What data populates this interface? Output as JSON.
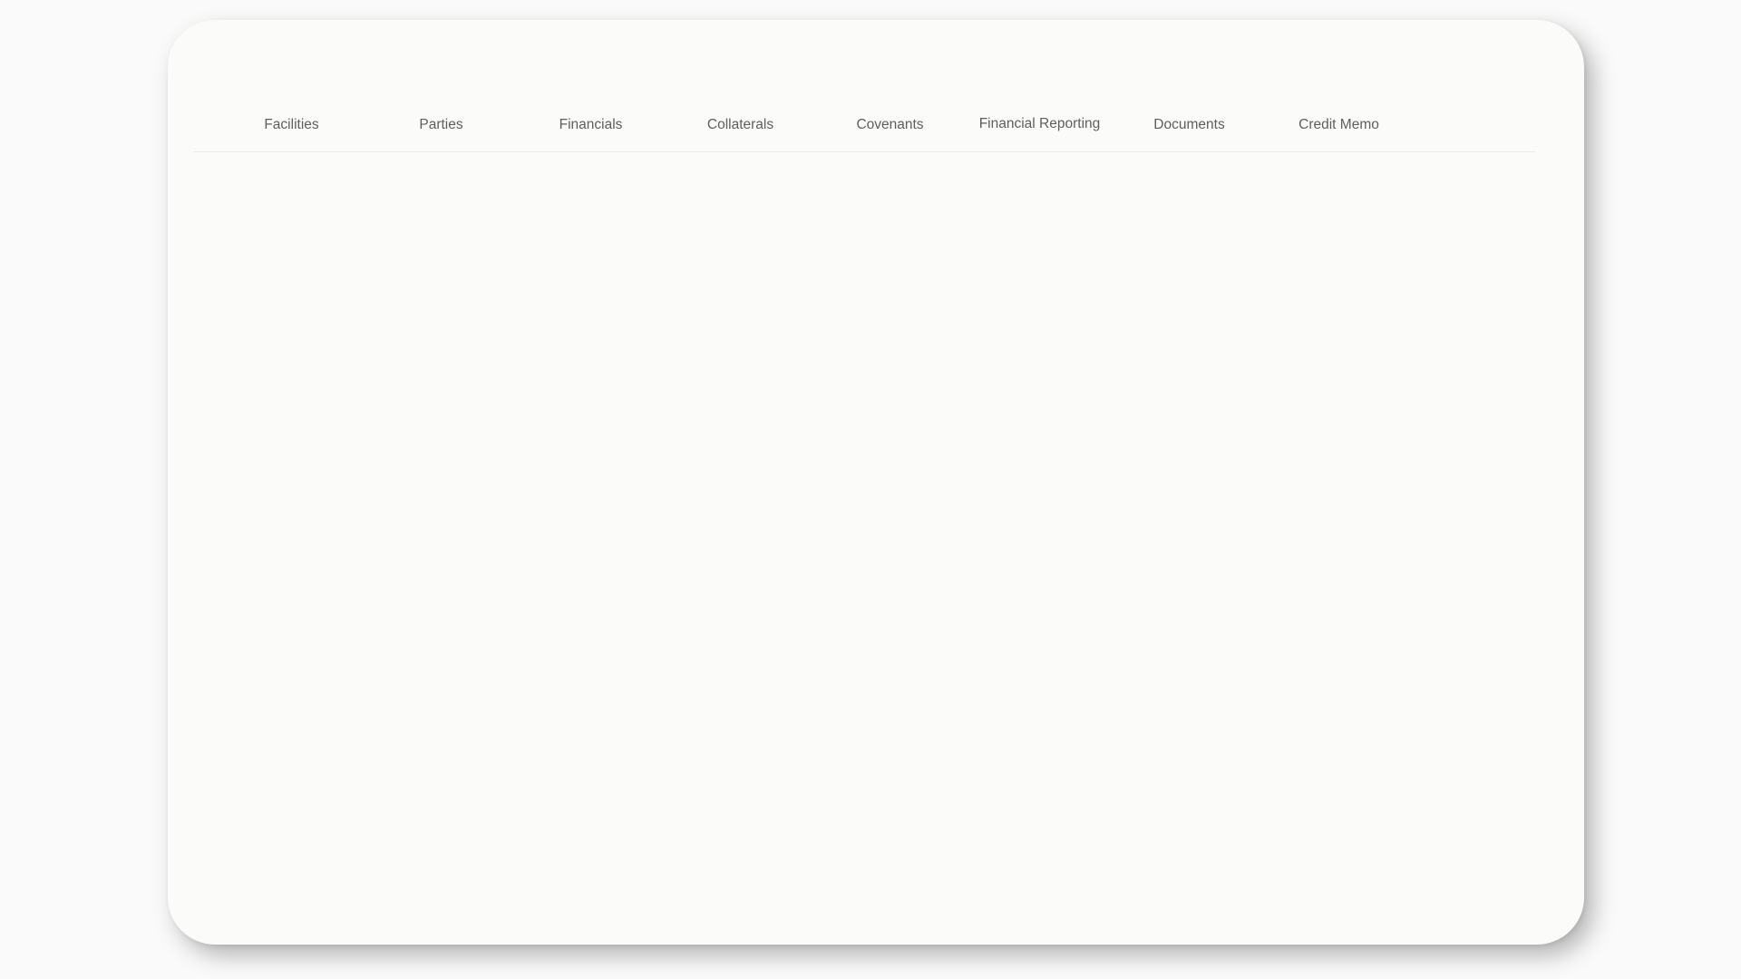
{
  "tabs": [
    {
      "label": "Facilities"
    },
    {
      "label": "Parties"
    },
    {
      "label": "Financials"
    },
    {
      "label": "Collaterals"
    },
    {
      "label": "Covenants"
    },
    {
      "label": "Financial Reporting"
    },
    {
      "label": "Documents"
    },
    {
      "label": "Credit Memo"
    }
  ]
}
